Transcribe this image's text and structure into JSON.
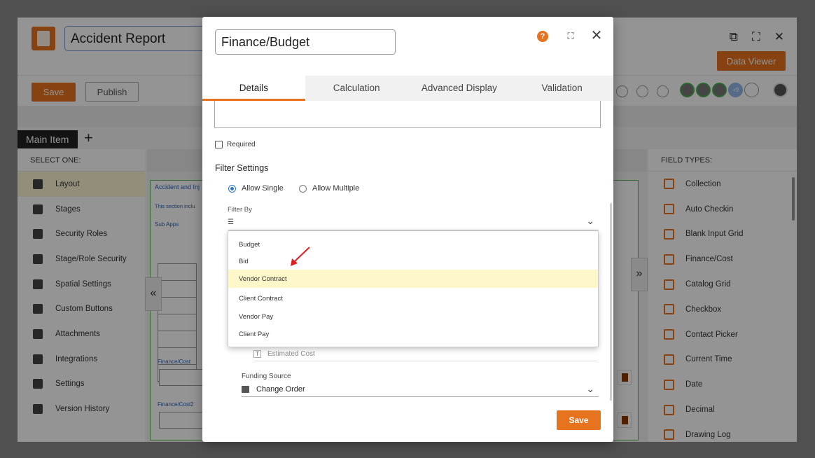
{
  "app": {
    "title": "Accident Report",
    "data_viewer_label": "Data Viewer",
    "save_label": "Save",
    "publish_label": "Publish",
    "avatars_extra": "+9",
    "main_item_tab": "Main Item",
    "add_tab": "+",
    "left_panel": {
      "heading": "SELECT ONE:",
      "items": [
        "Layout",
        "Stages",
        "Security Roles",
        "Stage/Role Security",
        "Spatial Settings",
        "Custom Buttons",
        "Attachments",
        "Integrations",
        "Settings",
        "Version History"
      ]
    },
    "canvas": {
      "section_title": "Accident and Inj",
      "section_desc": "This section inclu",
      "sub_apps": "Sub Apps",
      "field1": "Finance/Cost",
      "field2": "Finance/Cost2"
    },
    "right_panel": {
      "heading": "FIELD TYPES:",
      "items": [
        "Collection",
        "Auto Checkin",
        "Blank Input Grid",
        "Finance/Cost",
        "Catalog Grid",
        "Checkbox",
        "Contact Picker",
        "Current Time",
        "Date",
        "Decimal",
        "Drawing Log"
      ]
    }
  },
  "modal": {
    "field_name": "Finance/Budget",
    "help": "?",
    "tabs": [
      "Details",
      "Calculation",
      "Advanced Display",
      "Validation"
    ],
    "required_label": "Required",
    "filter_settings_title": "Filter Settings",
    "allow_single": "Allow Single",
    "allow_multiple": "Allow Multiple",
    "filter_by_label": "Filter By",
    "dropdown_options": [
      "Budget",
      "Bid",
      "Vendor Contract",
      "Client Contract",
      "Vendor Pay",
      "Client Pay"
    ],
    "estimated_cost": "Estimated Cost",
    "funding_source_label": "Funding Source",
    "funding_source_value": "Change Order",
    "save_label": "Save"
  },
  "colors": {
    "accent": "#e8731f",
    "highlight": "#fdf7c9",
    "radio_active": "#2a76d2",
    "annotation_arrow": "#e02020"
  }
}
